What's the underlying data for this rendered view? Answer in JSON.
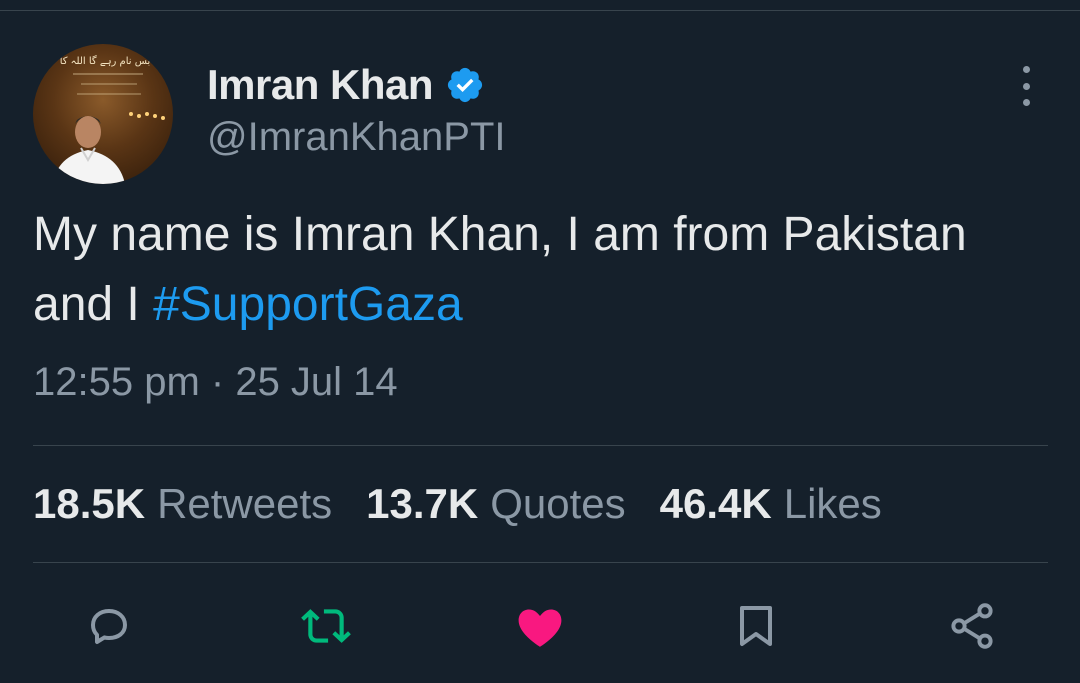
{
  "user": {
    "display_name": "Imran Khan",
    "handle": "@ImranKhanPTI",
    "verified": true,
    "avatar_banner_text": "بس نام رہے گا اللہ کا"
  },
  "tweet": {
    "text_main": "My name is Imran Khan, I am from Pakistan and I ",
    "hashtag": "#SupportGaza",
    "timestamp": "12:55 pm · 25 Jul 14"
  },
  "stats": {
    "retweets_count": "18.5K",
    "retweets_label": "Retweets",
    "quotes_count": "13.7K",
    "quotes_label": "Quotes",
    "likes_count": "46.4K",
    "likes_label": "Likes"
  },
  "actions": {
    "reply_icon": "reply-icon",
    "retweet_icon": "retweet-icon",
    "like_icon": "heart-icon",
    "bookmark_icon": "bookmark-icon",
    "share_icon": "share-icon"
  },
  "colors": {
    "background": "#15202b",
    "text_primary": "#e7e9ea",
    "text_secondary": "#8b98a5",
    "link": "#1d9bf0",
    "retweet_active": "#00ba7c",
    "like_active": "#f91880",
    "divider": "#38444d"
  }
}
